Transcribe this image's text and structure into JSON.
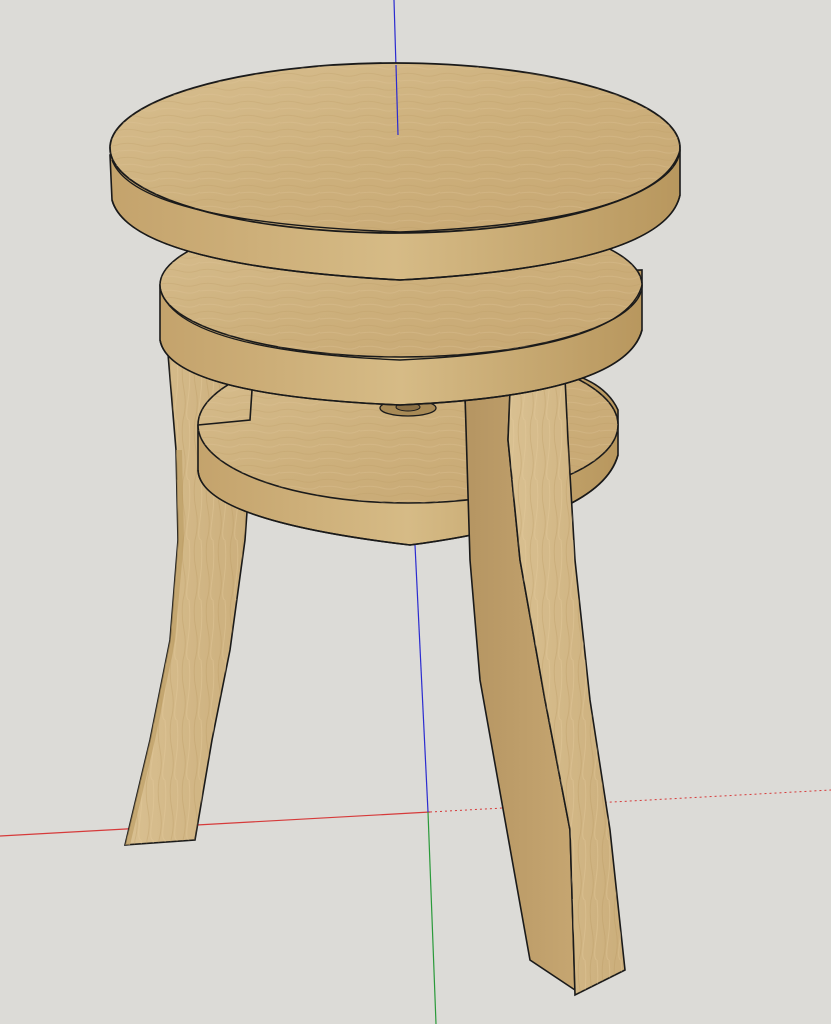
{
  "viewport": {
    "background": "#dcdbd7"
  },
  "model": {
    "name": "stool",
    "material": "light oak wood",
    "wood_light": "#d4b887",
    "wood_mid": "#c6a671",
    "wood_dark": "#a88a56",
    "edge_color": "#1a1a1a",
    "parts": [
      "top-seat-disc",
      "middle-disc",
      "lower-shelf-disc",
      "center-bolt",
      "left-leg",
      "front-right-leg"
    ]
  },
  "axes": {
    "red_axis_color": "#d63a3a",
    "green_axis_color": "#2a9a3a",
    "blue_axis_color": "#2b2bd0",
    "icons": [
      "red-axis",
      "green-axis",
      "blue-axis"
    ]
  }
}
